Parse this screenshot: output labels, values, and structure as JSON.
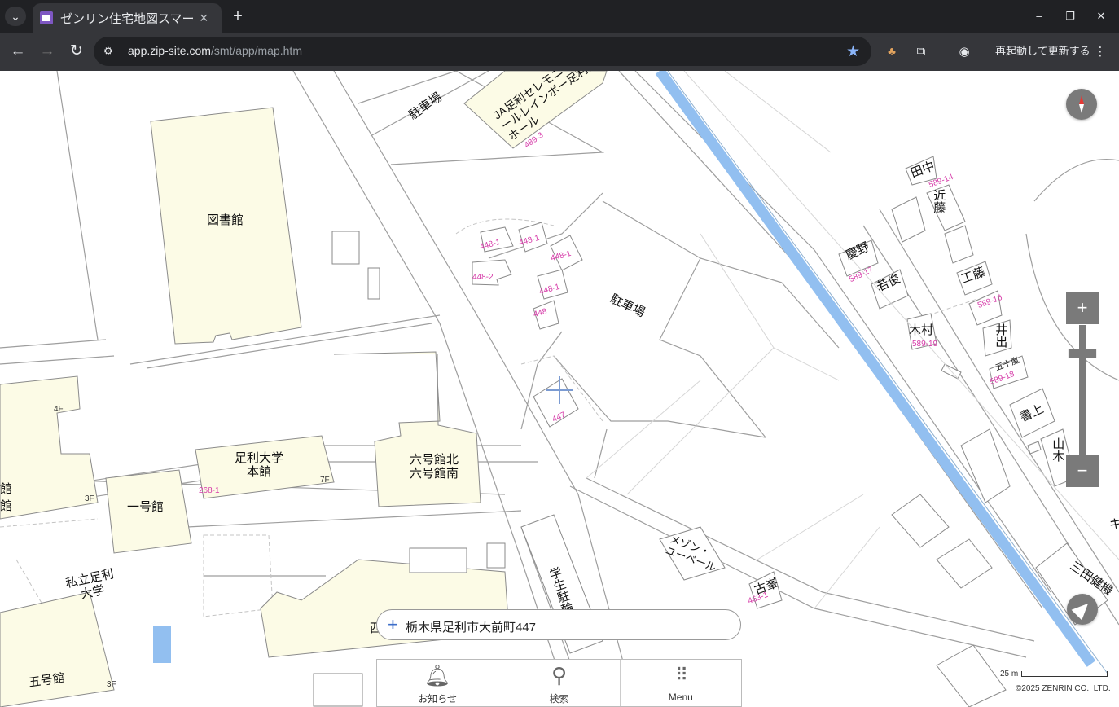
{
  "browser": {
    "tab_title": "ゼンリン住宅地図スマー",
    "url_host": "app.zip-site.com",
    "url_path": "/smt/app/map.htm",
    "relaunch_label": "再起動して更新する",
    "window_buttons": {
      "minimize": "–",
      "restore": "❐",
      "close": "✕"
    },
    "icons": [
      "tab-menu-icon",
      "close-icon",
      "new-tab-icon",
      "back-icon",
      "forward-icon",
      "reload-icon",
      "site-info-icon",
      "star-icon",
      "extension-icon",
      "puzzle-icon",
      "profile-icon",
      "more-icon"
    ]
  },
  "map": {
    "labels": {
      "library": "図書館",
      "parking1": "駐車場",
      "ja_hall": "JA足利セレモニーホールレインボー足利西ホール",
      "parking2": "駐車場",
      "main_bldg": "足利大学\n本館",
      "bldg6": "六号館北\n六号館南",
      "bldg1": "一号館",
      "univ": "私立足利\n大学",
      "bldg5": "五号館",
      "student_parking": "学生駐輪場",
      "west": "西",
      "kan": "館",
      "kan2": "館",
      "tanaka": "田中",
      "kondo": "近藤",
      "keino": "慶野",
      "wakamatsu": "若俊",
      "kimura": "木村",
      "kudo": "工藤",
      "ide": "井出",
      "isoraku": "五十嵐",
      "shogami": "書上",
      "yama": "山木",
      "ki": "キ",
      "mitsuda": "三田健機",
      "maison": "メゾン・\nユーベール",
      "furumine": "古峯"
    },
    "parcels": {
      "p448_1a": "448-1",
      "p448_1b": "448-1",
      "p448_1c": "448-1",
      "p448_2": "448-2",
      "p448_1d": "448-1",
      "p448": "448",
      "p447": "447",
      "p268": "268-1",
      "p489": "489-3",
      "p589_14": "589-14",
      "p589_19": "589-19",
      "p589_18": "589-18",
      "p589_16": "589-16",
      "p589_17": "589-17",
      "p463": "463-1"
    },
    "floors": {
      "f4": "4F",
      "f3a": "3F",
      "f7": "7F",
      "f3b": "3F"
    }
  },
  "controls": {
    "zoom_in": "+",
    "zoom_out": "−",
    "zoom_level": 0.83,
    "compass_icon": "compass-icon",
    "locate_icon": "location-arrow-icon"
  },
  "address_bar": {
    "plus": "+",
    "address": "栃木県足利市大前町447"
  },
  "bottom_nav": {
    "news": "お知らせ",
    "search": "検索",
    "menu": "Menu"
  },
  "scale": {
    "label": "25 m"
  },
  "copyright": "©2025 ZENRIN CO., LTD."
}
